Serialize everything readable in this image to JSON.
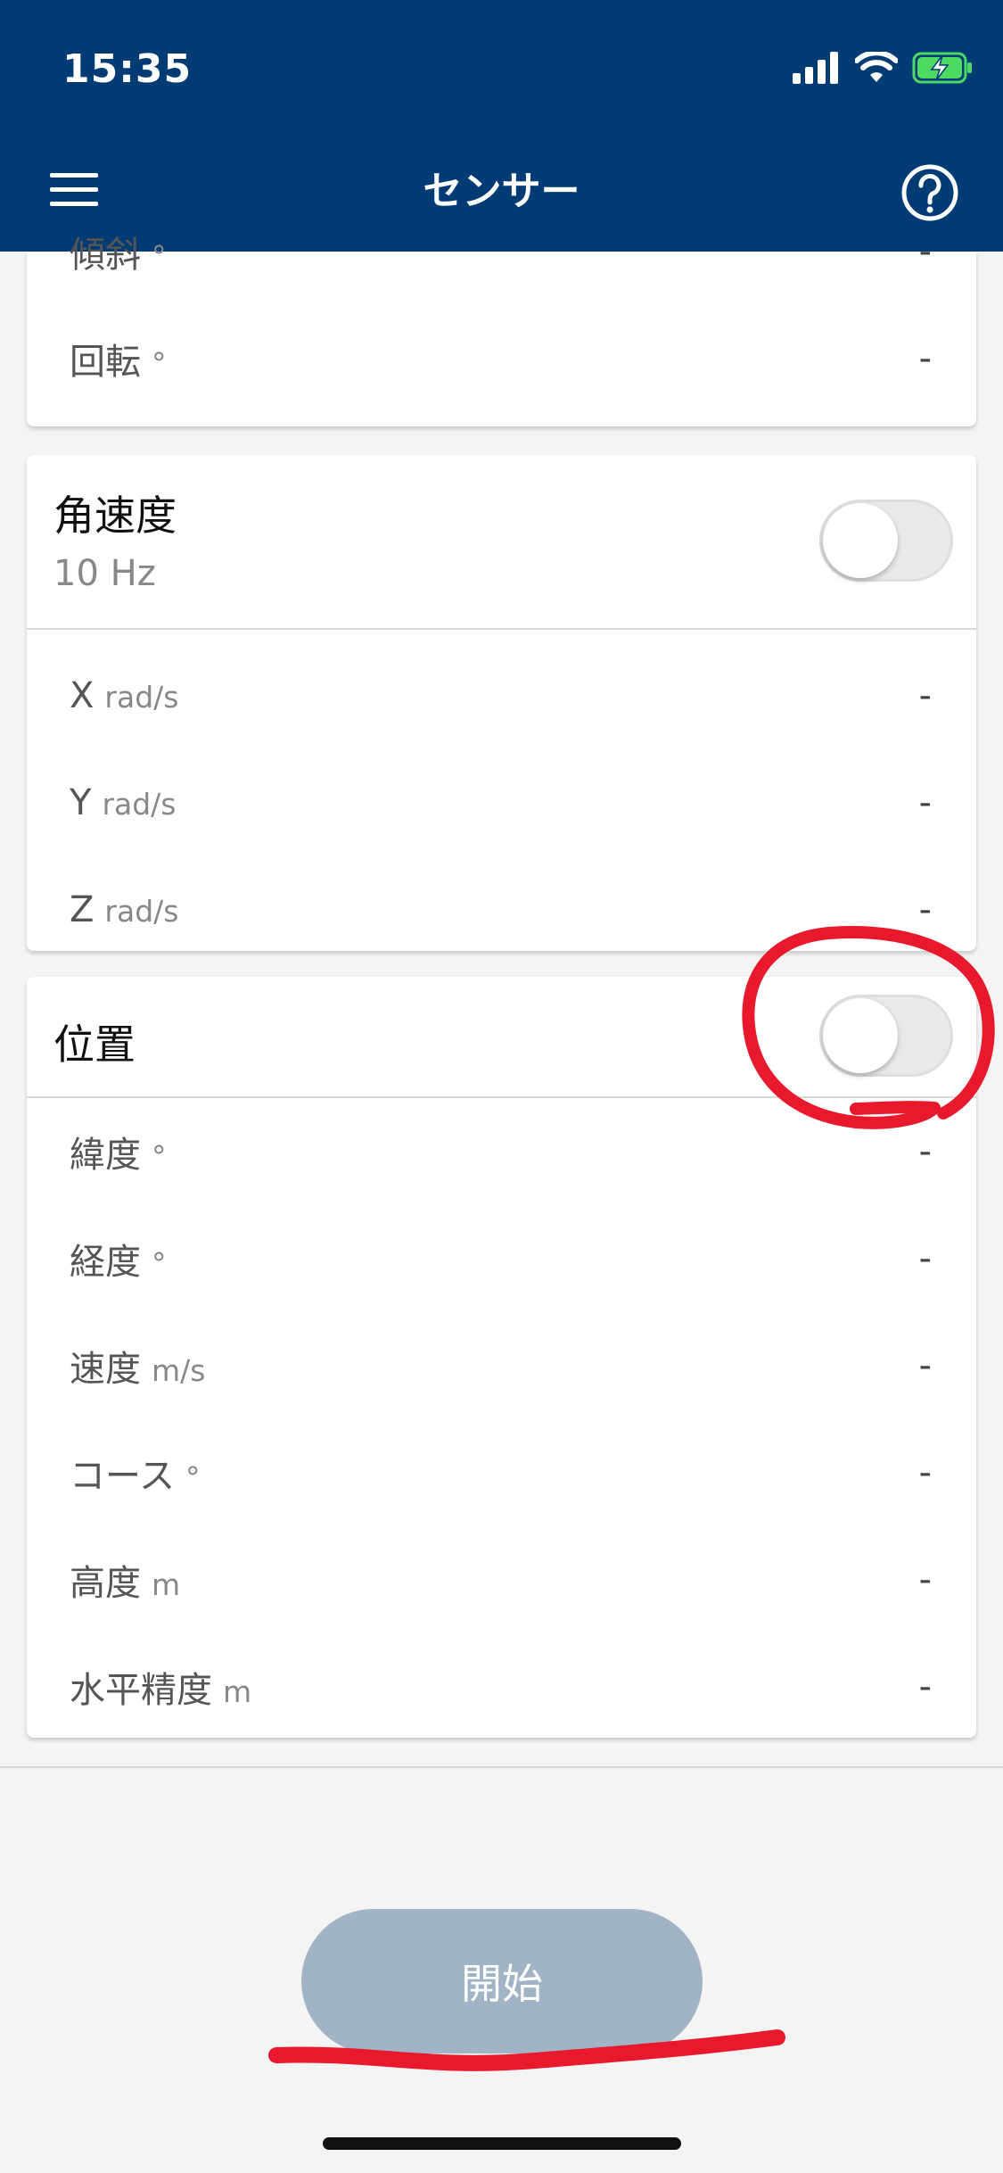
{
  "status_bar": {
    "time": "15:35"
  },
  "nav": {
    "title": "センサー"
  },
  "attitude_card": {
    "rows": [
      {
        "label": "傾斜",
        "unit": "°",
        "value": "-"
      },
      {
        "label": "回転",
        "unit": "°",
        "value": "-"
      }
    ]
  },
  "angular_velocity_card": {
    "title": "角速度",
    "subtitle": "10 Hz",
    "toggle_on": false,
    "rows": [
      {
        "label": "X",
        "unit": "rad/s",
        "value": "-"
      },
      {
        "label": "Y",
        "unit": "rad/s",
        "value": "-"
      },
      {
        "label": "Z",
        "unit": "rad/s",
        "value": "-"
      }
    ]
  },
  "location_card": {
    "title": "位置",
    "toggle_on": false,
    "rows": [
      {
        "label": "緯度",
        "unit": "°",
        "value": "-"
      },
      {
        "label": "経度",
        "unit": "°",
        "value": "-"
      },
      {
        "label": "速度",
        "unit": "m/s",
        "value": "-"
      },
      {
        "label": "コース",
        "unit": "°",
        "value": "-"
      },
      {
        "label": "高度",
        "unit": "m",
        "value": "-"
      },
      {
        "label": "水平精度",
        "unit": "m",
        "value": "-"
      }
    ]
  },
  "footer": {
    "start_label": "開始"
  },
  "colors": {
    "header_bg": "#003b73",
    "start_button_bg": "#a0b4c6",
    "annotation_red": "#e8192c",
    "battery_green": "#4cd964"
  }
}
